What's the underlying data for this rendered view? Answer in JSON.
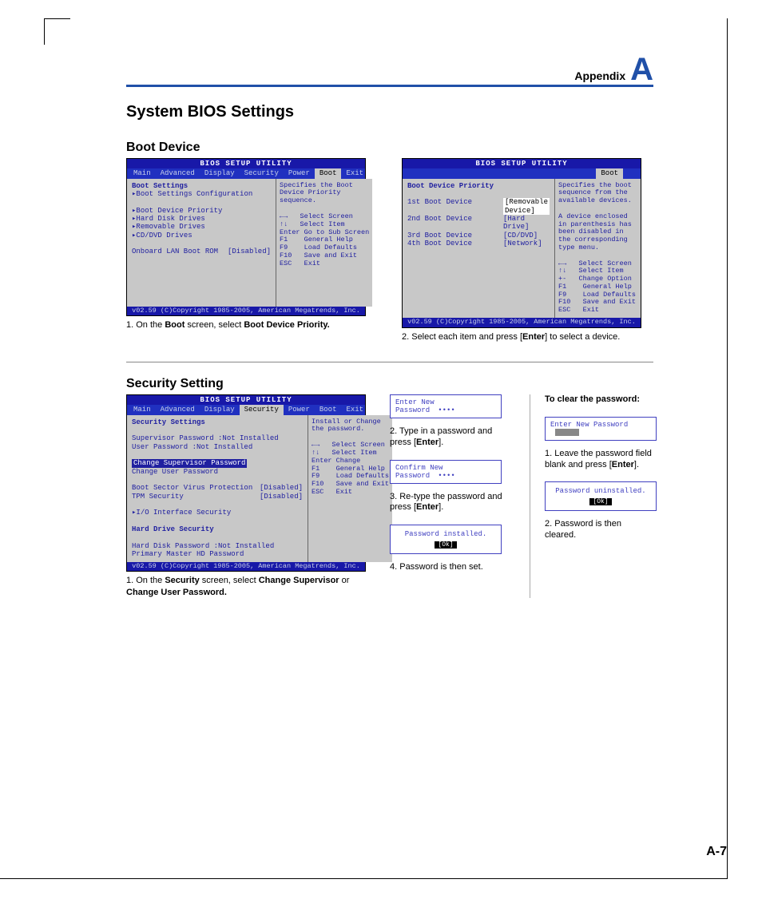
{
  "header": {
    "appendix": "Appendix",
    "letter": "A"
  },
  "title": "System BIOS Settings",
  "page_number": "A-7",
  "boot": {
    "heading": "Boot Device",
    "screen1": {
      "title": "BIOS SETUP UTILITY",
      "menus": [
        "Main",
        "Advanced",
        "Display",
        "Security",
        "Power",
        "Boot",
        "Exit"
      ],
      "active_menu": "Boot",
      "panel_heading": "Boot Settings",
      "items": [
        "Boot Settings Configuration",
        "Boot Device Priority",
        "Hard Disk Drives",
        "Removable Drives",
        "CD/DVD Drives"
      ],
      "option_label": "Onboard LAN Boot ROM",
      "option_value": "[Disabled]",
      "help": "Specifies the Boot Device Priority sequence.",
      "keys": [
        "←→   Select Screen",
        "↑↓   Select Item",
        "Enter Go to Sub Screen",
        "F1    General Help",
        "F9    Load Defaults",
        "F10   Save and Exit",
        "ESC   Exit"
      ],
      "footer": "v02.59 (C)Copyright 1985-2005, American Megatrends, Inc.",
      "caption_prefix": "1. On the ",
      "caption_bold1": "Boot",
      "caption_mid": " screen, select ",
      "caption_bold2": "Boot Device Priority."
    },
    "screen2": {
      "title": "BIOS SETUP UTILITY",
      "active_menu": "Boot",
      "panel_heading": "Boot Device Priority",
      "rows": [
        {
          "k": "1st Boot Device",
          "v": "[Removable Device]",
          "sel": true
        },
        {
          "k": "2nd Boot Device",
          "v": "[Hard Drive]"
        },
        {
          "k": "3rd Boot Device",
          "v": "[CD/DVD]"
        },
        {
          "k": "4th Boot Device",
          "v": "[Network]"
        }
      ],
      "help": "Specifies the boot sequence from the available devices.\n\nA device enclosed in parenthesis has been disabled in the corresponding type menu.",
      "keys": [
        "←→   Select Screen",
        "↑↓   Select Item",
        "+-   Change Option",
        "F1    General Help",
        "F9    Load Defaults",
        "F10   Save and Exit",
        "ESC   Exit"
      ],
      "footer": "v02.59 (C)Copyright 1985-2005, American Megatrends, Inc.",
      "caption_prefix": "2. Select each item and press [",
      "caption_bold": "Enter",
      "caption_suffix": "] to select a device."
    }
  },
  "security": {
    "heading": "Security Setting",
    "screen": {
      "title": "BIOS SETUP UTILITY",
      "menus": [
        "Main",
        "Advanced",
        "Display",
        "Security",
        "Power",
        "Boot",
        "Exit"
      ],
      "active_menu": "Security",
      "panel_heading": "Security Settings",
      "lines": [
        "Supervisor Password  :Not Installed",
        "User Password        :Not Installed"
      ],
      "sel_line": "Change Supervisor Password",
      "after_sel": "Change User Password",
      "opts": [
        {
          "k": "Boot Sector Virus Protection",
          "v": "[Disabled]"
        },
        {
          "k": "TPM Security",
          "v": "[Disabled]"
        }
      ],
      "sub": "I/O Interface Security",
      "hd_heading": "Hard Drive Security",
      "hd_lines": [
        "Hard Disk Password  :Not Installed",
        "Primary Master HD Password"
      ],
      "help": "Install or Change the password.",
      "keys": [
        "←→   Select Screen",
        "↑↓   Select Item",
        "Enter Change",
        "F1    General Help",
        "F9    Load Defaults",
        "F10   Save and Exit",
        "ESC   Exit"
      ],
      "footer": "v02.59 (C)Copyright 1985-2005, American Megatrends, Inc.",
      "caption_prefix": "1. On the ",
      "caption_bold1": "Security",
      "caption_mid": " screen, select ",
      "caption_bold2": "Change Supervisor",
      "caption_or": " or ",
      "caption_bold3": "Change User Password."
    },
    "steps_mid": {
      "box1": "Enter New Password",
      "cap1a": "2. Type in a password and press [",
      "cap1b": "Enter",
      "cap1c": "].",
      "box2": "Confirm New Password",
      "cap2a": "3. Re-type the password and press [",
      "cap2b": "Enter",
      "cap2c": "].",
      "box3": "Password installed.",
      "ok": "[Ok]",
      "cap3": "4. Password is then set."
    },
    "steps_right": {
      "heading": "To clear the password:",
      "box1": "Enter New Password",
      "cap1a": "1. Leave the password field blank and press [",
      "cap1b": "Enter",
      "cap1c": "].",
      "box2": "Password uninstalled.",
      "ok": "[Ok]",
      "cap2": "2. Password is then cleared."
    }
  }
}
